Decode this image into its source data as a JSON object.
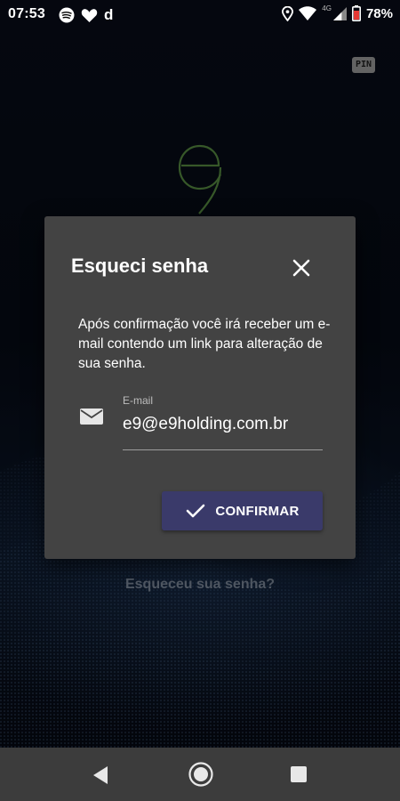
{
  "status_bar": {
    "time": "07:53",
    "left_icons": [
      "spotify-icon",
      "heart-icon",
      "d-app-icon"
    ],
    "app_letter": "d",
    "network_label": "4G",
    "battery_percent": "78%"
  },
  "app": {
    "pin_label": "PIN",
    "forgot_password_link": "Esqueceu sua senha?"
  },
  "dialog": {
    "title": "Esqueci senha",
    "message": "Após confirmação você irá receber um e-mail contendo um link para alteração de sua senha.",
    "email_label": "E-mail",
    "email_value": "e9@e9holding.com.br",
    "confirm_label": "CONFIRMAR"
  },
  "colors": {
    "dialog_bg": "#434343",
    "confirm_button": "#3a3a6a",
    "logo_green": "#4d7a3a",
    "link_gray": "#6f7a8a"
  }
}
